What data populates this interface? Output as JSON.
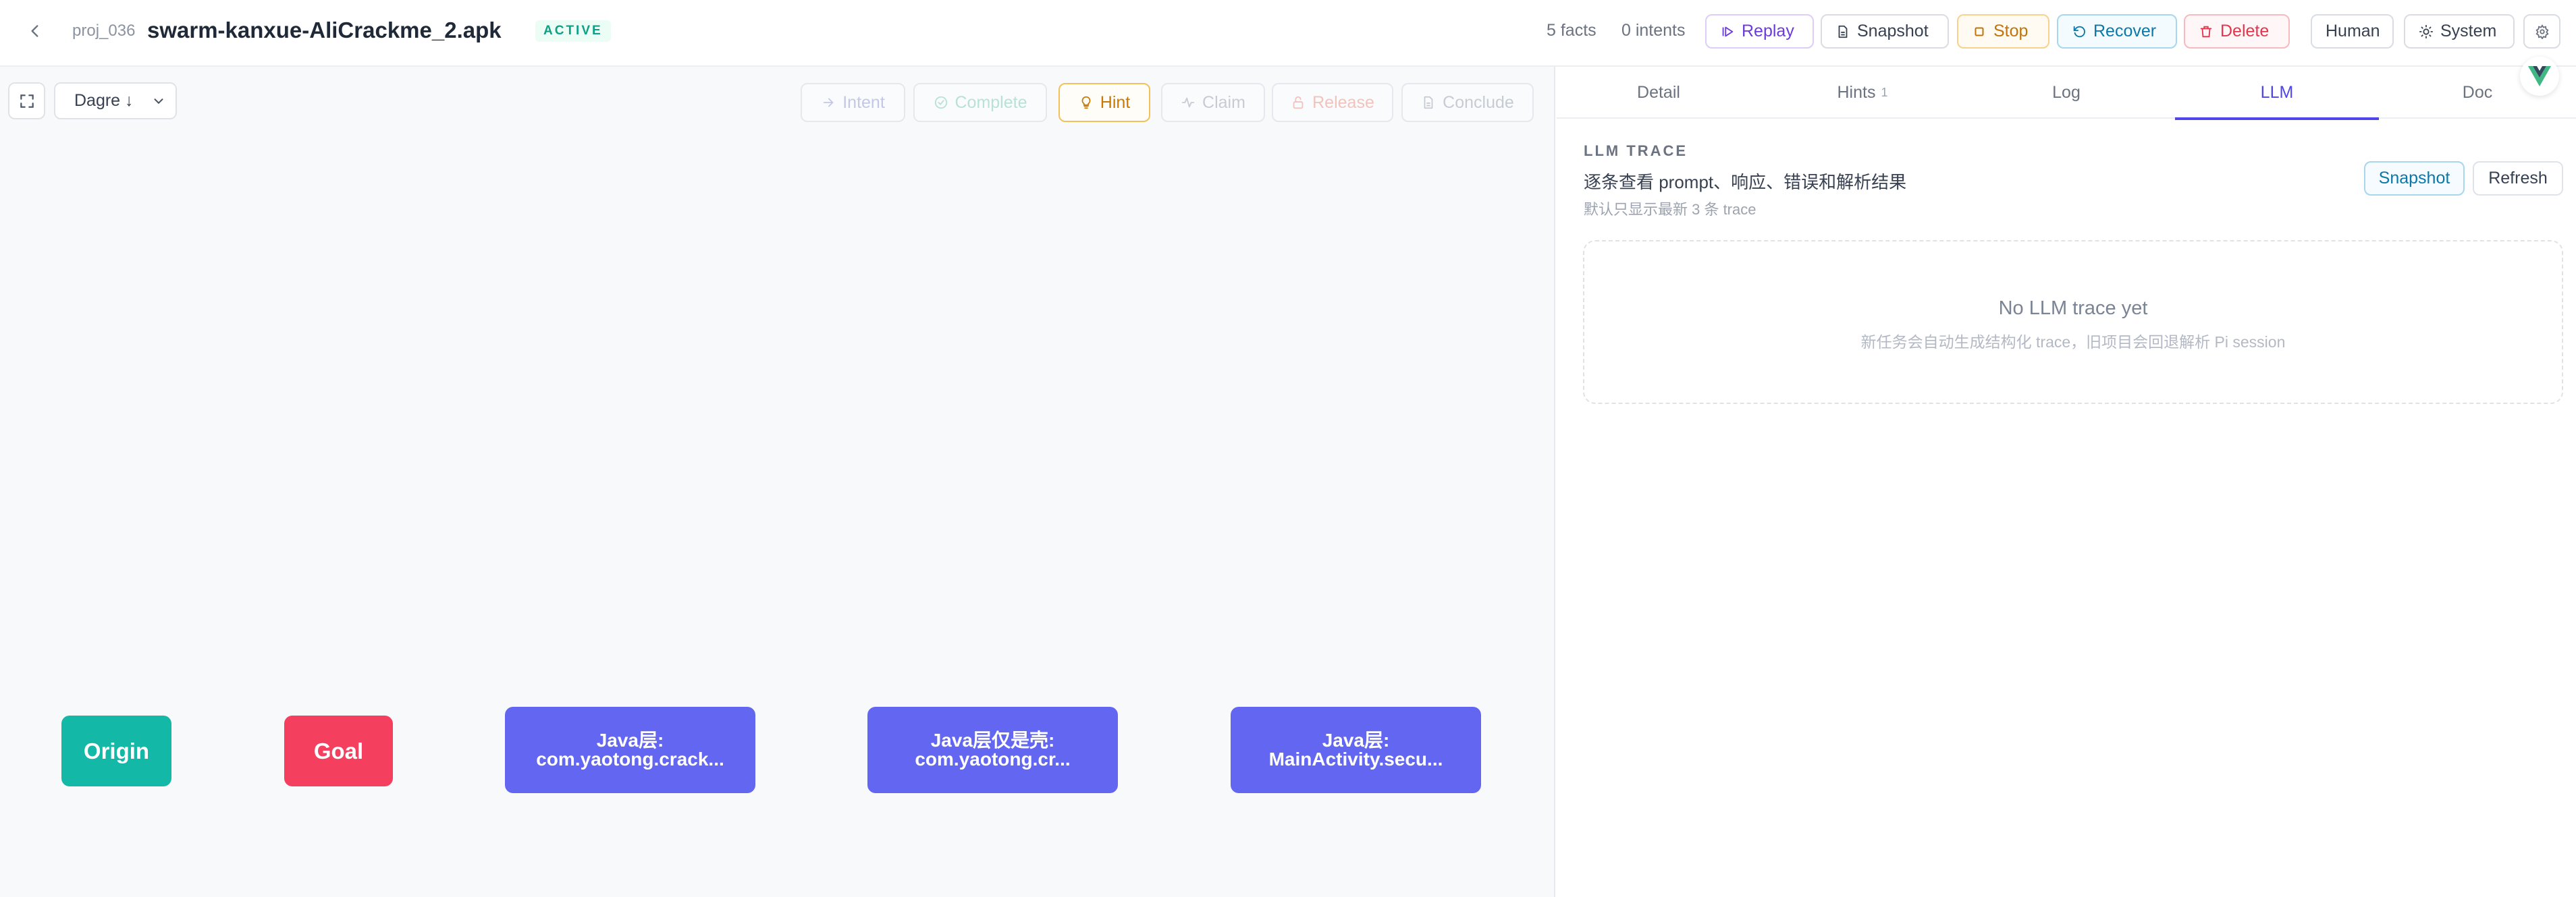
{
  "header": {
    "project_id": "proj_036",
    "project_name": "swarm-kanxue-AliCrackme_2.apk",
    "status": "ACTIVE",
    "facts": "5 facts",
    "intents": "0 intents",
    "buttons": {
      "replay": "Replay",
      "snapshot": "Snapshot",
      "stop": "Stop",
      "recover": "Recover",
      "delete": "Delete",
      "human": "Human",
      "system": "System"
    }
  },
  "graph": {
    "layout_value": "Dagre ↓",
    "actions": {
      "intent": "Intent",
      "complete": "Complete",
      "hint": "Hint",
      "claim": "Claim",
      "release": "Release",
      "conclude": "Conclude"
    },
    "nodes": [
      {
        "label": "Origin"
      },
      {
        "label": "Goal"
      },
      {
        "label": "Java层: com.yaotong.crack..."
      },
      {
        "label": "Java层仅是壳: com.yaotong.cr..."
      },
      {
        "label": "Java层: MainActivity.secu..."
      }
    ]
  },
  "panel": {
    "tabs": {
      "detail": "Detail",
      "hints": "Hints",
      "hints_count": "1",
      "log": "Log",
      "llm": "LLM",
      "doc": "Doc"
    },
    "section_label": "LLM TRACE",
    "section_desc": "逐条查看 prompt、响应、错误和解析结果",
    "section_sub": "默认只显示最新 3 条 trace",
    "snapshot_label": "Snapshot",
    "refresh_label": "Refresh",
    "empty_title": "No LLM trace yet",
    "empty_sub": "新任务会自动生成结构化 trace，旧项目会回退解析 Pi session"
  },
  "colors": {
    "accent": "#4f46e5",
    "origin": "#14b8a6",
    "goal": "#f43f5e",
    "java_node": "#6366f1"
  }
}
